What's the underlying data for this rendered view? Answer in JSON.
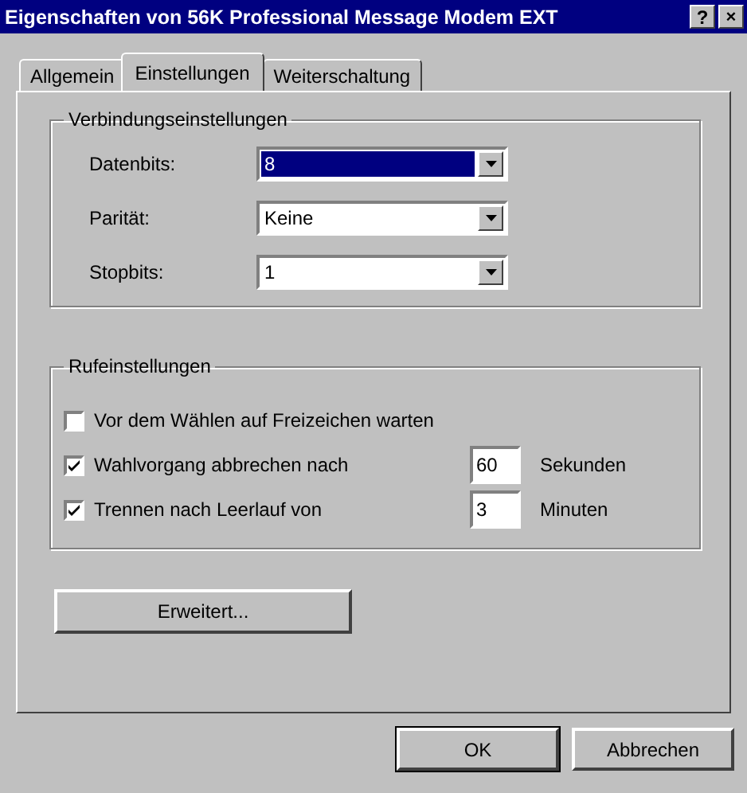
{
  "window": {
    "title": "Eigenschaften von 56K Professional Message Modem EXT",
    "controls": [
      {
        "kind": "help",
        "label": "?"
      },
      {
        "kind": "close",
        "label": "×"
      }
    ]
  },
  "tabs": [
    {
      "label": "Allgemein",
      "selected": false
    },
    {
      "label": "Einstellungen",
      "selected": true
    },
    {
      "label": "Weiterschaltung",
      "selected": false
    }
  ],
  "connection": {
    "title": "Verbindungseinstellungen",
    "fields": [
      {
        "label": "Datenbits:",
        "value": "8",
        "focused": true
      },
      {
        "label": "Parität:",
        "value": "Keine",
        "focused": false
      },
      {
        "label": "Stopbits:",
        "value": "1",
        "focused": false
      }
    ]
  },
  "calling": {
    "title": "Rufeinstellungen",
    "options": [
      {
        "label": "Vor dem Wählen auf Freizeichen warten",
        "checked": false
      },
      {
        "label": "Wahlvorgang abbrechen nach",
        "checked": true,
        "value": "60",
        "unit": "Sekunden"
      },
      {
        "label": "Trennen nach Leerlauf von",
        "checked": true,
        "value": "3",
        "unit": "Minuten"
      }
    ]
  },
  "advanced_button": "Erweitert...",
  "buttons": [
    {
      "label": "OK",
      "default": true
    },
    {
      "label": "Abbrechen",
      "default": false
    }
  ]
}
